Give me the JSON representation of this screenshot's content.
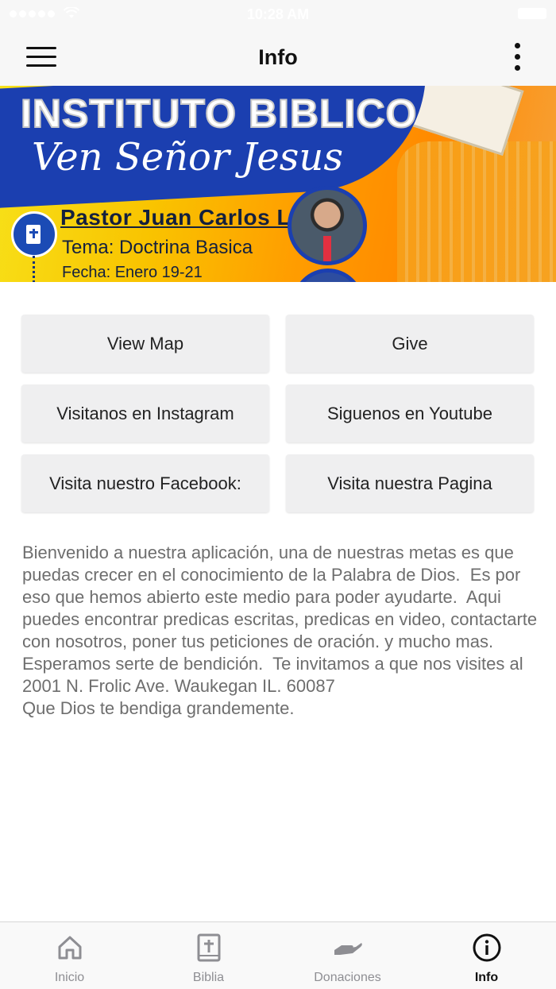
{
  "status_bar": {
    "time": "10:28 AM"
  },
  "nav": {
    "title": "Info",
    "menu_icon": "hamburger-menu-icon",
    "more_icon": "vertical-ellipsis-icon"
  },
  "banner": {
    "title": "INSTITUTO BIBLICO",
    "script": "Ven Señor Jesus",
    "pastor": "Pastor Juan Carlos Lima",
    "tema": "Tema: Doctrina Basica",
    "fecha": "Fecha: Enero 19-21"
  },
  "buttons": [
    {
      "label": "View Map"
    },
    {
      "label": "Give"
    },
    {
      "label": "Visitanos en Instagram"
    },
    {
      "label": "Siguenos en Youtube"
    },
    {
      "label": "Visita nuestro Facebook:"
    },
    {
      "label": "Visita nuestra Pagina"
    }
  ],
  "description": "Bienvenido a nuestra aplicación, una de nuestras metas es que puedas crecer en el conocimiento de la Palabra de Dios.  Es por eso que hemos abierto este medio para poder ayudarte.  Aqui puedes encontrar predicas escritas, predicas en video, contactarte con nosotros, poner tus peticiones de oración. y mucho mas.  Esperamos serte de bendición.  Te invitamos a que nos visites al 2001 N. Frolic Ave. Waukegan IL. 60087\nQue Dios te bendiga grandemente.",
  "tabs": [
    {
      "label": "Inicio",
      "icon": "home-icon"
    },
    {
      "label": "Biblia",
      "icon": "bible-icon"
    },
    {
      "label": "Donaciones",
      "icon": "donation-hand-icon"
    },
    {
      "label": "Info",
      "icon": "info-icon",
      "active": true
    }
  ],
  "colors": {
    "active_tab": "#111111",
    "inactive_tab": "#8e8e93",
    "button_bg": "#efeff0",
    "banner_blue": "#1b3fb0"
  }
}
